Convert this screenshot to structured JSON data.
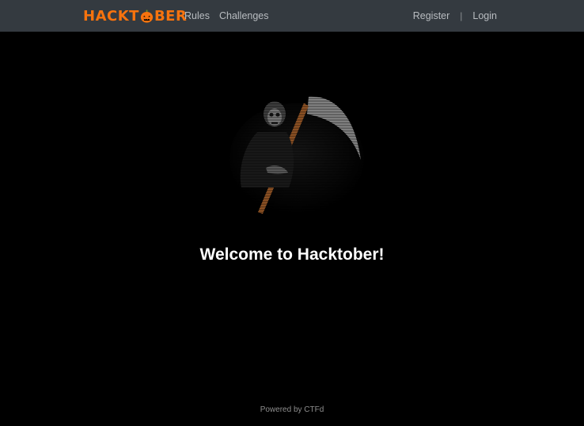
{
  "navbar": {
    "brand_prefix": "HACKT",
    "brand_suffix": "BER",
    "left_links": [
      {
        "label": "Rules"
      },
      {
        "label": "Challenges"
      }
    ],
    "right_links": [
      {
        "label": "Register"
      },
      {
        "label": "Login"
      }
    ],
    "separator": "|"
  },
  "hero": {
    "image_icon": "grim-reaper-scythe-icon"
  },
  "main": {
    "title": "Welcome to Hacktober!"
  },
  "footer": {
    "text": "Powered by CTFd"
  },
  "colors": {
    "navbar_bg": "#343a40",
    "brand": "#f7730e",
    "background": "#000000"
  }
}
